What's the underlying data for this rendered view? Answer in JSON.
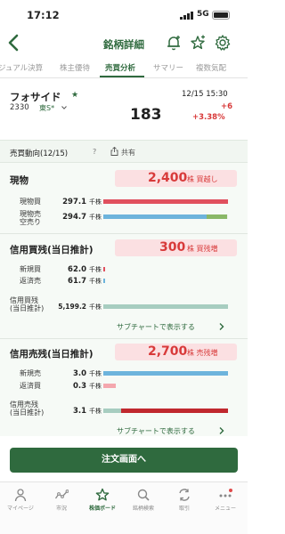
{
  "status": {
    "time": "17:12",
    "network": "5G"
  },
  "nav": {
    "title": "銘柄詳細"
  },
  "tabs": [
    {
      "label": "ジュアル決算"
    },
    {
      "label": "株主優待"
    },
    {
      "label": "売買分析"
    },
    {
      "label": "サマリー"
    },
    {
      "label": "複数気配"
    }
  ],
  "stock": {
    "name": "フォサイド",
    "code": "2330",
    "market": "東S*",
    "datetime": "12/15 15:30",
    "price": "183",
    "change": "+6",
    "change_pct": "+3.38%"
  },
  "section": {
    "title": "売買動向(12/15)",
    "help": "?",
    "share": "共有"
  },
  "genbutsu": {
    "title": "現物",
    "badge_value": "2,400",
    "badge_unit": "株 買越し",
    "rows": [
      {
        "label": "現物買",
        "value": "297.1",
        "unit": "千株"
      },
      {
        "label": "現物売\n空売り",
        "value": "294.7",
        "unit": "千株"
      }
    ]
  },
  "margin_buy": {
    "title": "信用買残(当日推計)",
    "badge_value": "300",
    "badge_unit": "株 買残増",
    "rows": [
      {
        "label": "新規買",
        "value": "62.0",
        "unit": "千株"
      },
      {
        "label": "返済売",
        "value": "61.7",
        "unit": "千株"
      }
    ],
    "balance_label": "信用買残\n(当日推計)",
    "balance_value": "5,199.2",
    "balance_unit": "千株",
    "link": "サブチャートで表示する"
  },
  "margin_sell": {
    "title": "信用売残(当日推計)",
    "badge_value": "2,700",
    "badge_unit": "株 売残増",
    "rows": [
      {
        "label": "新規売",
        "value": "3.0",
        "unit": "千株"
      },
      {
        "label": "返済買",
        "value": "0.3",
        "unit": "千株"
      }
    ],
    "balance_label": "信用売残\n(当日推計)",
    "balance_value": "3.1",
    "balance_unit": "千株",
    "link": "サブチャートで表示する"
  },
  "order_button": "注文画面へ",
  "bottom_nav": [
    {
      "label": "マイページ",
      "icon": "person-icon"
    },
    {
      "label": "市況",
      "icon": "market-icon"
    },
    {
      "label": "株価ボード",
      "icon": "star-icon"
    },
    {
      "label": "銘柄検索",
      "icon": "search-icon"
    },
    {
      "label": "取引",
      "icon": "trade-icon"
    },
    {
      "label": "メニュー",
      "icon": "menu-icon"
    }
  ],
  "colors": {
    "accent": "#2f6a3e",
    "buy": "#e0505e",
    "sell": "#6db4dc",
    "short": "#8ab868",
    "badge_bg": "#fbe0e2"
  }
}
